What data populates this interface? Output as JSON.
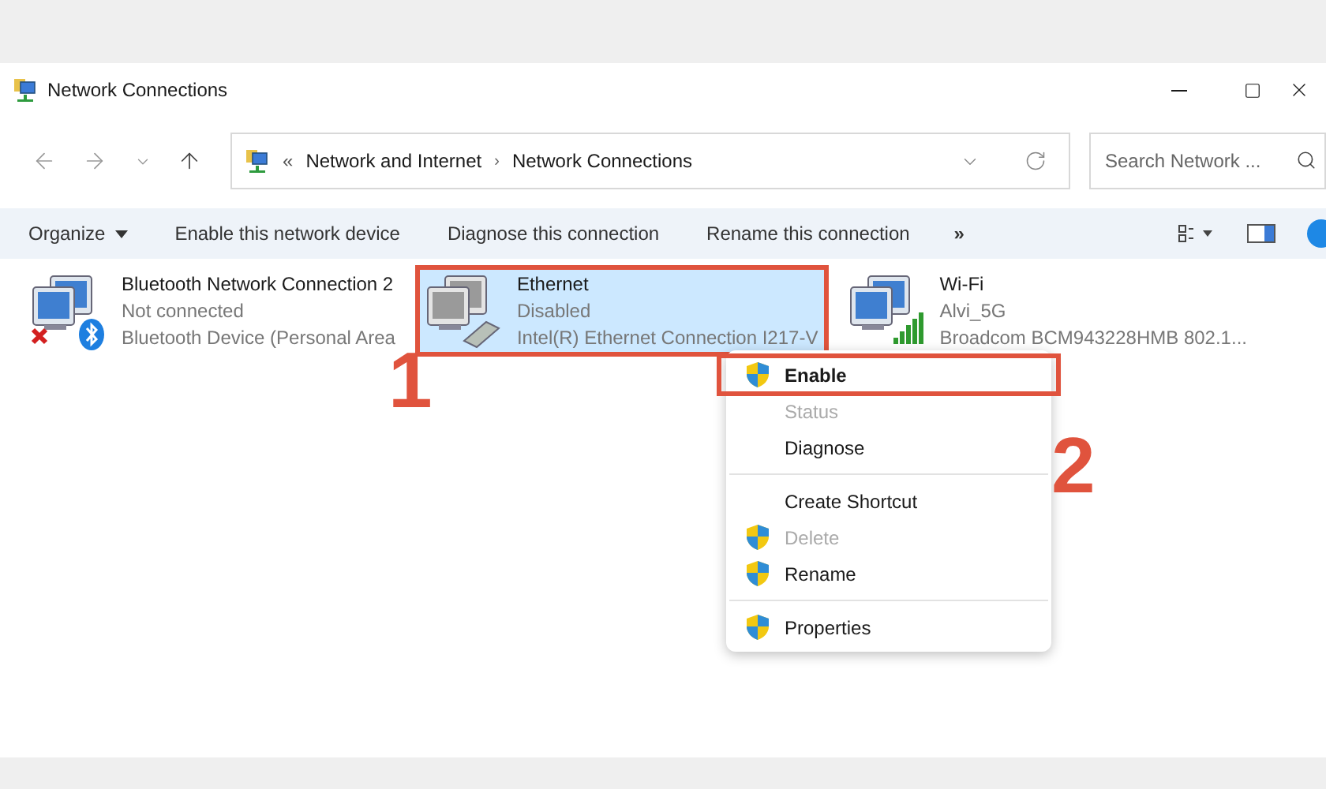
{
  "window": {
    "title": "Network Connections"
  },
  "address_bar": {
    "overflow": "«",
    "separator": "›",
    "path": [
      "Network and Internet",
      "Network Connections"
    ]
  },
  "search": {
    "placeholder": "Search Network ..."
  },
  "toolbar": {
    "items": [
      {
        "label": "Organize",
        "dropdown": true
      },
      {
        "label": "Enable this network device",
        "dropdown": false
      },
      {
        "label": "Diagnose this connection",
        "dropdown": false
      },
      {
        "label": "Rename this connection",
        "dropdown": false
      }
    ],
    "more": "»"
  },
  "connections": [
    {
      "kind": "bluetooth",
      "name": "Bluetooth Network Connection 2",
      "status": "Not connected",
      "device": "Bluetooth Device (Personal Area",
      "selected": false,
      "marked": false
    },
    {
      "kind": "ethernet",
      "name": "Ethernet",
      "status": "Disabled",
      "device": "Intel(R) Ethernet Connection I217-V",
      "selected": true,
      "marked": true
    },
    {
      "kind": "wifi",
      "name": "Wi-Fi",
      "status": "Alvi_5G",
      "device": "Broadcom BCM943228HMB 802.1...",
      "selected": false,
      "marked": false
    }
  ],
  "context_menu": {
    "items": [
      {
        "kind": "item",
        "label": "Enable",
        "shield": true,
        "bold": true,
        "disabled": false,
        "marked": true
      },
      {
        "kind": "item",
        "label": "Status",
        "shield": false,
        "bold": false,
        "disabled": true,
        "marked": false
      },
      {
        "kind": "item",
        "label": "Diagnose",
        "shield": false,
        "bold": false,
        "disabled": false,
        "marked": false
      },
      {
        "kind": "separator"
      },
      {
        "kind": "item",
        "label": "Create Shortcut",
        "shield": false,
        "bold": false,
        "disabled": false,
        "marked": false
      },
      {
        "kind": "item",
        "label": "Delete",
        "shield": true,
        "bold": false,
        "disabled": true,
        "marked": false
      },
      {
        "kind": "item",
        "label": "Rename",
        "shield": true,
        "bold": false,
        "disabled": false,
        "marked": false
      },
      {
        "kind": "separator"
      },
      {
        "kind": "item",
        "label": "Properties",
        "shield": true,
        "bold": false,
        "disabled": false,
        "marked": false
      }
    ]
  },
  "annotations": [
    "1",
    "2"
  ]
}
